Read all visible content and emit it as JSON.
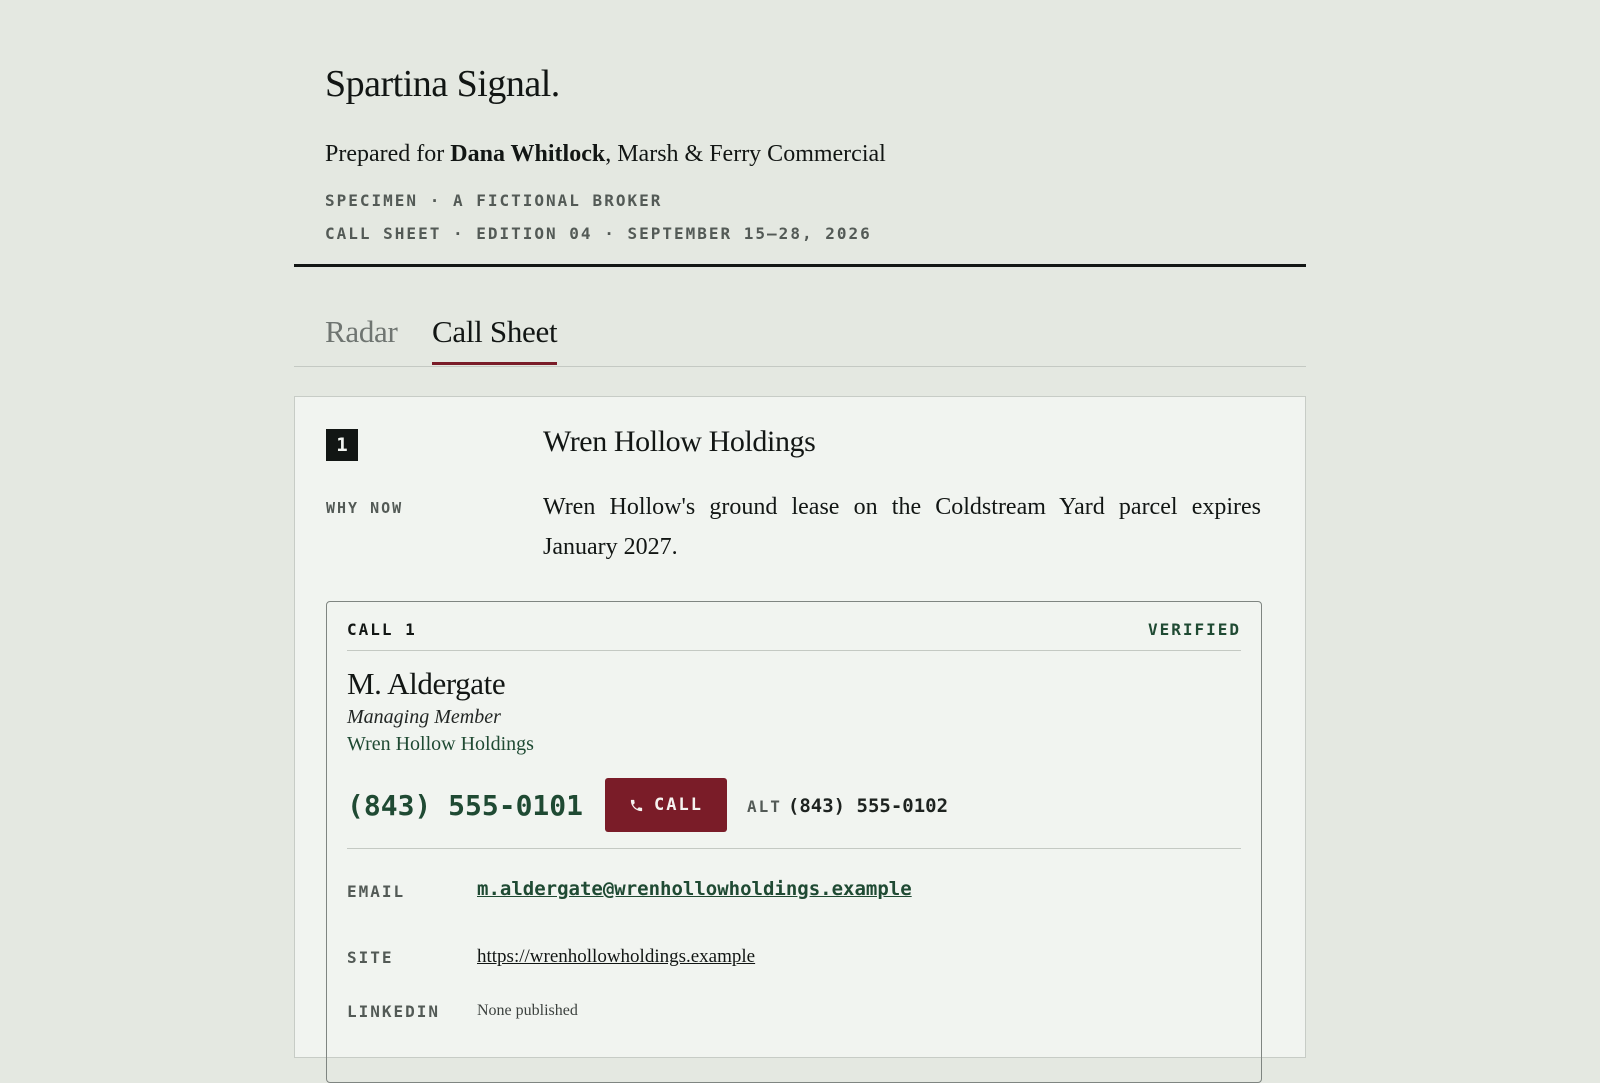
{
  "brand": "Spartina Signal.",
  "prepared": {
    "prefix": "Prepared for ",
    "name": "Dana Whitlock",
    "suffix": ", Marsh & Ferry Commercial"
  },
  "meta_line_1": "SPECIMEN · A FICTIONAL BROKER",
  "meta_line_2": "CALL SHEET · EDITION 04 · SEPTEMBER 15–28, 2026",
  "tabs": [
    {
      "label": "Radar",
      "active": false
    },
    {
      "label": "Call Sheet",
      "active": true
    }
  ],
  "card": {
    "rank": "1",
    "company": "Wren Hollow Holdings",
    "why_now_label": "WHY NOW",
    "why_now_text": "Wren Hollow's ground lease on the Coldstream Yard parcel expires January 2027.",
    "call": {
      "label": "CALL 1",
      "status": "VERIFIED",
      "person": "M. Aldergate",
      "role": "Managing Member",
      "org": "Wren Hollow Holdings",
      "phone": "(843) 555-0101",
      "call_button": "CALL",
      "alt_label": "ALT",
      "alt_phone": "(843) 555-0102",
      "email_label": "EMAIL",
      "email": "m.aldergate@wrenhollowholdings.example",
      "site_label": "SITE",
      "site": "https://wrenhollowholdings.example",
      "linkedin_label": "LINKEDIN",
      "linkedin": "None published"
    }
  },
  "colors": {
    "background": "#e4e8e1",
    "accent": "#7a1c28",
    "green": "#1f4a33"
  },
  "icons": {
    "call_button_icon": "phone-icon"
  }
}
